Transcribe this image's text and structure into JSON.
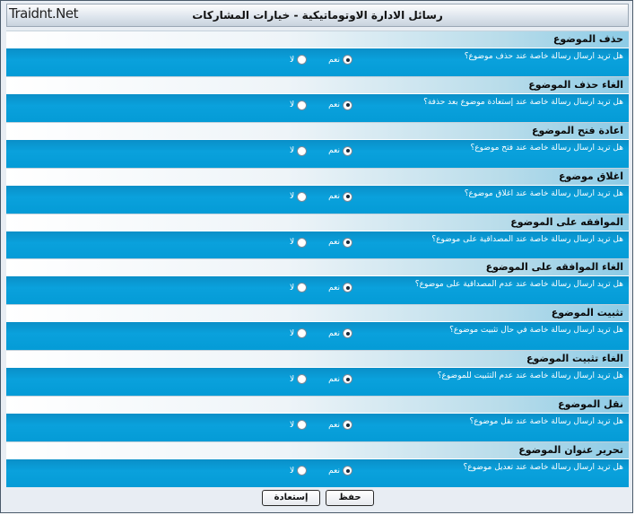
{
  "watermark": "Traidnt.Net",
  "header": {
    "title": "رسائل الادارة الاوتوماتيكية - خيارات المشاركات"
  },
  "options": {
    "yes": "نعم",
    "no": "لا"
  },
  "sections": [
    {
      "title": "حذف الموضوع",
      "question": "هل تريد ارسال رسالة خاصة عند حذف موضوع؟",
      "selected": "yes"
    },
    {
      "title": "الغاء حذف الموضوع",
      "question": "هل تريد ارسال رسالة خاصة عند إستعادة موضوع بعد حذفة؟",
      "selected": "yes"
    },
    {
      "title": "اعادة فتح الموضوع",
      "question": "هل تريد ارسال رسالة خاصة عند فتح موضوع؟",
      "selected": "yes"
    },
    {
      "title": "اغلاق موضوع",
      "question": "هل تريد ارسال رسالة خاصة عند اغلاق موضوع؟",
      "selected": "yes"
    },
    {
      "title": "الموافقه على الموضوع",
      "question": "هل تريد ارسال رسالة خاصة عند المصداقية على موضوع؟",
      "selected": "yes"
    },
    {
      "title": "الغاء الموافقه على الموضوع",
      "question": "هل تريد ارسال رسالة خاصة عند عدم المصداقية على موضوع؟",
      "selected": "yes"
    },
    {
      "title": "تثبيت الموضوع",
      "question": "هل تريد ارسال رسالة خاصة في حال تثبيت موضوع؟",
      "selected": "yes"
    },
    {
      "title": "الغاء تثبيت الموضوع",
      "question": "هل تريد ارسال رسالة خاصة عند عدم التثبيت للموضوع؟",
      "selected": "yes"
    },
    {
      "title": "نقل الموضوع",
      "question": "هل تريد ارسال رسالة خاصة عند نقل موضوع؟",
      "selected": "yes"
    },
    {
      "title": "تحرير عنوان الموضوع",
      "question": "هل تريد ارسال رسالة خاصة عند تعديل موضوع؟",
      "selected": "yes"
    }
  ],
  "footer": {
    "save_label": "حفظ",
    "restore_label": "إستعادة"
  }
}
